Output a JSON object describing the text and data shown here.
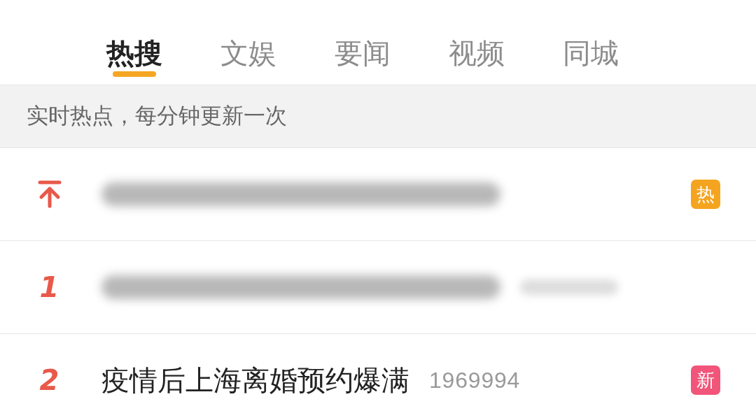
{
  "tabs": [
    {
      "label": "热搜",
      "selected": true
    },
    {
      "label": "文娱",
      "selected": false
    },
    {
      "label": "要闻",
      "selected": false
    },
    {
      "label": "视频",
      "selected": false
    },
    {
      "label": "同城",
      "selected": false
    }
  ],
  "notice": "实时热点，每分钟更新一次",
  "rows": [
    {
      "kind": "pinned",
      "title_blurred": true,
      "count_blurred": false,
      "badge": {
        "label": "热",
        "color": "#f5a41f"
      }
    },
    {
      "kind": "ranked",
      "rank": "1",
      "title_blurred": true,
      "count_blurred": true
    },
    {
      "kind": "ranked",
      "rank": "2",
      "title_blurred": false,
      "title": "疫情后上海离婚预约爆满",
      "count_blurred": false,
      "count": "1969994",
      "badge": {
        "label": "新",
        "color": "#f1557a"
      }
    }
  ]
}
